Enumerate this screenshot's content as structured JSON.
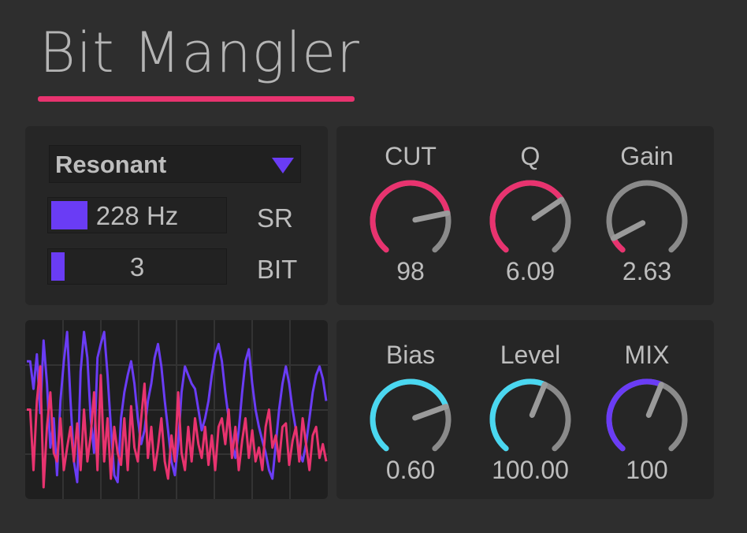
{
  "title": "Bit Mangler",
  "colors": {
    "accent_pink": "#e8336f",
    "accent_purple": "#6a3cf5",
    "accent_cyan": "#4ad7f0",
    "knob_track": "#8a8a8a"
  },
  "settings": {
    "mode": "Resonant",
    "dropdown_icon": "triangle-down-icon",
    "sr": {
      "label": "SR",
      "value": "228 Hz",
      "fill": 0.21
    },
    "bit": {
      "label": "BIT",
      "value": "3",
      "fill": 0.08
    }
  },
  "filter_knobs": [
    {
      "name": "CUT",
      "value": "98",
      "level": 0.78,
      "color": "#e8336f"
    },
    {
      "name": "Q",
      "value": "6.09",
      "level": 0.7,
      "color": "#e8336f"
    },
    {
      "name": "Gain",
      "value": "2.63",
      "level": 0.08,
      "color": "#e8336f"
    }
  ],
  "output_knobs": [
    {
      "name": "Bias",
      "value": "0.60",
      "level": 0.75,
      "color": "#4ad7f0"
    },
    {
      "name": "Level",
      "value": "100.00",
      "level": 0.58,
      "color": "#4ad7f0"
    },
    {
      "name": "MIX",
      "value": "100",
      "level": 0.58,
      "color": "#6a3cf5"
    }
  ],
  "scope": {
    "input_wave": [
      0.22,
      0.22,
      0.38,
      0.18,
      0.52,
      0.1,
      0.35,
      0.72,
      0.55,
      0.88,
      0.45,
      0.22,
      0.05,
      0.45,
      0.8,
      0.92,
      0.28,
      0.05,
      0.2,
      0.55,
      0.75,
      0.2,
      0.12,
      0.05,
      0.3,
      0.6,
      0.88,
      0.92,
      0.55,
      0.4,
      0.3,
      0.22,
      0.35,
      0.55,
      0.7,
      0.62,
      0.45,
      0.35,
      0.2,
      0.12,
      0.25,
      0.45,
      0.62,
      0.8,
      0.88,
      0.7,
      0.4,
      0.25,
      0.3,
      0.35,
      0.38,
      0.5,
      0.62,
      0.55,
      0.45,
      0.3,
      0.18,
      0.12,
      0.22,
      0.4,
      0.55,
      0.7,
      0.78,
      0.62,
      0.4,
      0.22,
      0.15,
      0.35,
      0.5,
      0.6,
      0.68,
      0.75,
      0.85,
      0.9,
      0.7,
      0.5,
      0.35,
      0.25,
      0.35,
      0.5,
      0.62,
      0.75,
      0.8,
      0.7,
      0.55,
      0.4,
      0.3,
      0.25,
      0.32,
      0.45
    ],
    "output_wave": [
      0.5,
      0.5,
      0.85,
      0.45,
      0.25,
      0.95,
      0.6,
      0.4,
      0.75,
      0.8,
      0.55,
      0.85,
      0.72,
      0.6,
      0.8,
      0.58,
      0.85,
      0.5,
      0.8,
      0.65,
      0.4,
      0.85,
      0.3,
      0.8,
      0.55,
      0.9,
      0.6,
      0.75,
      0.82,
      0.55,
      0.85,
      0.48,
      0.72,
      0.8,
      0.55,
      0.35,
      0.78,
      0.6,
      0.85,
      0.72,
      0.55,
      0.8,
      0.9,
      0.65,
      0.8,
      0.4,
      0.75,
      0.85,
      0.6,
      0.8,
      0.55,
      0.7,
      0.78,
      0.6,
      0.82,
      0.65,
      0.85,
      0.6,
      0.55,
      0.7,
      0.5,
      0.78,
      0.6,
      0.85,
      0.68,
      0.55,
      0.78,
      0.62,
      0.8,
      0.72,
      0.85,
      0.6,
      0.5,
      0.72,
      0.65,
      0.8,
      0.6,
      0.58,
      0.82,
      0.68,
      0.6,
      0.8,
      0.55,
      0.7,
      0.85,
      0.65,
      0.6,
      0.78,
      0.7,
      0.8
    ]
  }
}
